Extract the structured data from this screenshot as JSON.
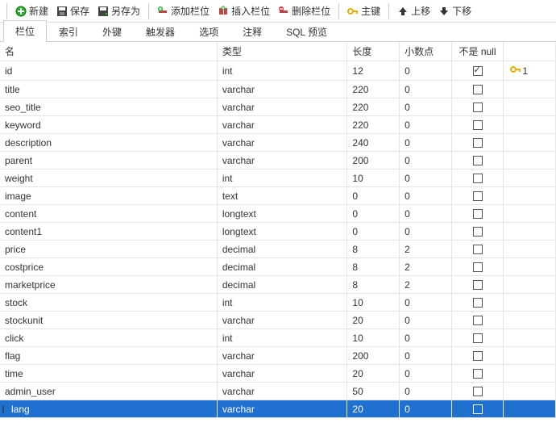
{
  "toolbar": {
    "new": "新建",
    "save": "保存",
    "saveas": "另存为",
    "addfield": "添加栏位",
    "insertfield": "插入栏位",
    "deletefield": "删除栏位",
    "primarykey": "主键",
    "moveup": "上移",
    "movedown": "下移"
  },
  "tabs": [
    {
      "label": "栏位",
      "active": true
    },
    {
      "label": "索引",
      "active": false
    },
    {
      "label": "外键",
      "active": false
    },
    {
      "label": "触发器",
      "active": false
    },
    {
      "label": "选项",
      "active": false
    },
    {
      "label": "注释",
      "active": false
    },
    {
      "label": "SQL 预览",
      "active": false
    }
  ],
  "columns": {
    "name": "名",
    "type": "类型",
    "length": "长度",
    "decimals": "小数点",
    "notnull": "不是 null"
  },
  "rows": [
    {
      "name": "id",
      "type": "int",
      "length": "12",
      "decimals": "0",
      "notnull": true,
      "pk": "1"
    },
    {
      "name": "title",
      "type": "varchar",
      "length": "220",
      "decimals": "0",
      "notnull": false
    },
    {
      "name": "seo_title",
      "type": "varchar",
      "length": "220",
      "decimals": "0",
      "notnull": false
    },
    {
      "name": "keyword",
      "type": "varchar",
      "length": "220",
      "decimals": "0",
      "notnull": false
    },
    {
      "name": "description",
      "type": "varchar",
      "length": "240",
      "decimals": "0",
      "notnull": false
    },
    {
      "name": "parent",
      "type": "varchar",
      "length": "200",
      "decimals": "0",
      "notnull": false
    },
    {
      "name": "weight",
      "type": "int",
      "length": "10",
      "decimals": "0",
      "notnull": false
    },
    {
      "name": "image",
      "type": "text",
      "length": "0",
      "decimals": "0",
      "notnull": false
    },
    {
      "name": "content",
      "type": "longtext",
      "length": "0",
      "decimals": "0",
      "notnull": false
    },
    {
      "name": "content1",
      "type": "longtext",
      "length": "0",
      "decimals": "0",
      "notnull": false
    },
    {
      "name": "price",
      "type": "decimal",
      "length": "8",
      "decimals": "2",
      "notnull": false
    },
    {
      "name": "costprice",
      "type": "decimal",
      "length": "8",
      "decimals": "2",
      "notnull": false
    },
    {
      "name": "marketprice",
      "type": "decimal",
      "length": "8",
      "decimals": "2",
      "notnull": false
    },
    {
      "name": "stock",
      "type": "int",
      "length": "10",
      "decimals": "0",
      "notnull": false
    },
    {
      "name": "stockunit",
      "type": "varchar",
      "length": "20",
      "decimals": "0",
      "notnull": false
    },
    {
      "name": "click",
      "type": "int",
      "length": "10",
      "decimals": "0",
      "notnull": false
    },
    {
      "name": "flag",
      "type": "varchar",
      "length": "200",
      "decimals": "0",
      "notnull": false
    },
    {
      "name": "time",
      "type": "varchar",
      "length": "20",
      "decimals": "0",
      "notnull": false
    },
    {
      "name": "admin_user",
      "type": "varchar",
      "length": "50",
      "decimals": "0",
      "notnull": false
    },
    {
      "name": "lang",
      "type": "varchar",
      "length": "20",
      "decimals": "0",
      "notnull": false,
      "selected": true
    }
  ]
}
